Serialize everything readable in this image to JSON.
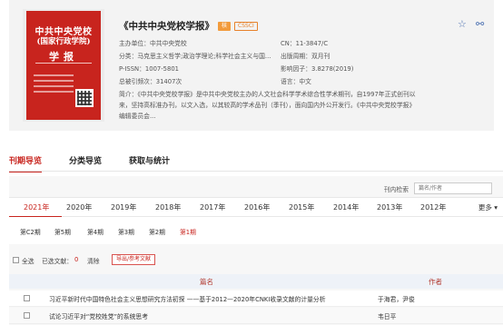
{
  "journal": {
    "title": "《中共中央党校学报》",
    "badges": [
      "核",
      "CSSCI"
    ],
    "cover": {
      "title_line1": "中共中央党校",
      "title_line2": "(国家行政学院)",
      "title_line3": "学报"
    },
    "info": {
      "organizer": "主办单位：中共中央党校",
      "cn": "CN：11-3847/C",
      "category": "分类：马克思主义哲学;政治学理论;科学社会主义与国...",
      "frequency": "出版周期：双月刊",
      "pissn": "P-ISSN：1007-5801",
      "impact": "影响因子：3.8278(2019)",
      "downloads": "总被引频次：31407次",
      "language": "语言：中文"
    },
    "description_prefix": "简介：《中共中央党校学报》是中共中央党校主办的人文社会科学学术综合性学术期刊，自1997年正式创刊以来，坚持高标准办刊，以文入选，以其较高的学术品刊（季刊），面向国内外公开发行。《中共中央党校学报》编辑委员会...",
    "actions": {
      "favorite": "☆",
      "share": "⚯"
    }
  },
  "tabs": [
    "刊期导览",
    "分类导览",
    "获取与统计"
  ],
  "search": {
    "label": "刊内检索",
    "placeholder": "篇名/作者"
  },
  "years": [
    "2021年",
    "2020年",
    "2019年",
    "2018年",
    "2017年",
    "2016年",
    "2015年",
    "2014年",
    "2013年",
    "2012年"
  ],
  "more_label": "更多 ▾",
  "issues": [
    "第C2期",
    "第5期",
    "第4期",
    "第3期",
    "第2期",
    "第1期"
  ],
  "toolbar": {
    "select_all": "全选",
    "selected_label": "已选文献：",
    "selected_count": "0",
    "clear": "清除",
    "export": "导出/参考文献"
  },
  "table": {
    "headers": [
      "篇名",
      "作者"
    ],
    "rows": [
      {
        "title": "习近平新时代中国特色社会主义思想研究方法初探 ——基于2012—2020年CNKI收录文献的计量分析",
        "author": "于海君，尹俊"
      },
      {
        "title": "试论习近平对“党校姓党”的系统思考",
        "author": "韦日平"
      }
    ]
  }
}
